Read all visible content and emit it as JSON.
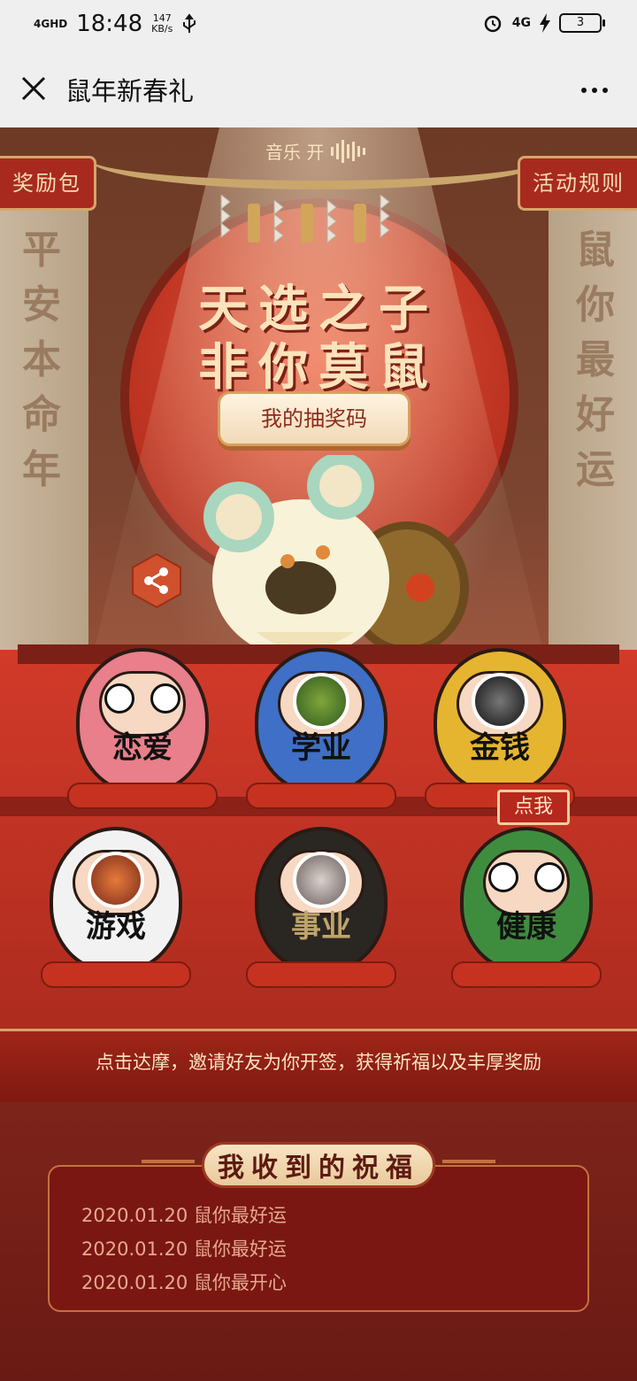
{
  "status_bar": {
    "signal": "4GHD",
    "time": "18:48",
    "speed_value": "147",
    "speed_unit": "KB/s",
    "network": "4G",
    "battery": "3"
  },
  "nav": {
    "title": "鼠年新春礼"
  },
  "scene": {
    "music_label": "音乐 开",
    "reward_button": "奖励包",
    "rules_button": "活动规则",
    "couplet_left": "平安本命年",
    "couplet_right": "鼠你最好运",
    "headline_1": "天选之子",
    "headline_2": "非你莫鼠",
    "lottery_code_button": "我的抽奖码",
    "tap_badge": "点我"
  },
  "darumas": [
    {
      "label": "恋爱",
      "color": "#e87f8a"
    },
    {
      "label": "学业",
      "color": "#3f6fc6"
    },
    {
      "label": "金钱",
      "color": "#e5b52f"
    },
    {
      "label": "游戏",
      "color": "#f2f2f2"
    },
    {
      "label": "事业",
      "color": "#2a2622"
    },
    {
      "label": "健康",
      "color": "#3e8d3f"
    }
  ],
  "invite_text": "点击达摩，邀请好友为你开签，获得祈福以及丰厚奖励",
  "blessings": {
    "title": "我收到的祝福",
    "items": [
      "2020.01.20 鼠你最好运",
      "2020.01.20 鼠你最好运",
      "2020.01.20 鼠你最开心"
    ]
  }
}
